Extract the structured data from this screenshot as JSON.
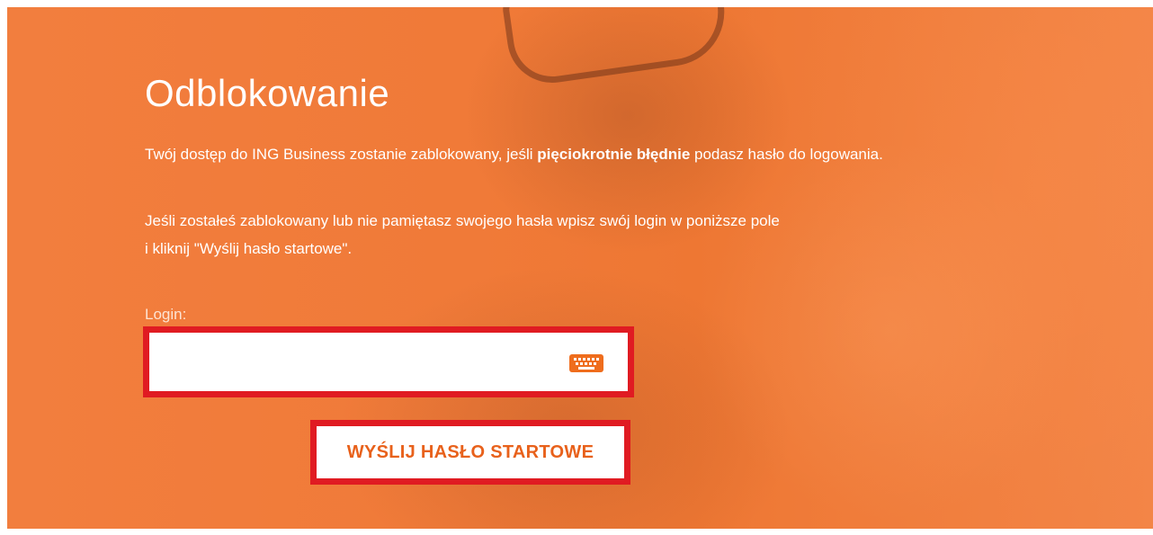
{
  "page": {
    "title": "Odblokowanie",
    "para1": {
      "before": "Twój dostęp do ING Business zostanie zablokowany, jeśli ",
      "bold": "pięciokrotnie błędnie",
      "after": " podasz hasło do logowania."
    },
    "para2": {
      "line1": "Jeśli zostałeś zablokowany lub nie pamiętasz swojego hasła wpisz swój login w poniższe pole",
      "line2": "i kliknij \"Wyślij hasło startowe\"."
    }
  },
  "form": {
    "login_label": "Login:",
    "login_value": "",
    "keyboard_icon": "keyboard-icon",
    "submit_label": "WYŚLIJ HASŁO STARTOWE"
  },
  "colors": {
    "background": "#f07c3a",
    "highlight_border": "#e01b22",
    "button_text": "#e8611b",
    "icon": "#ef6d1d",
    "text": "#ffffff"
  }
}
